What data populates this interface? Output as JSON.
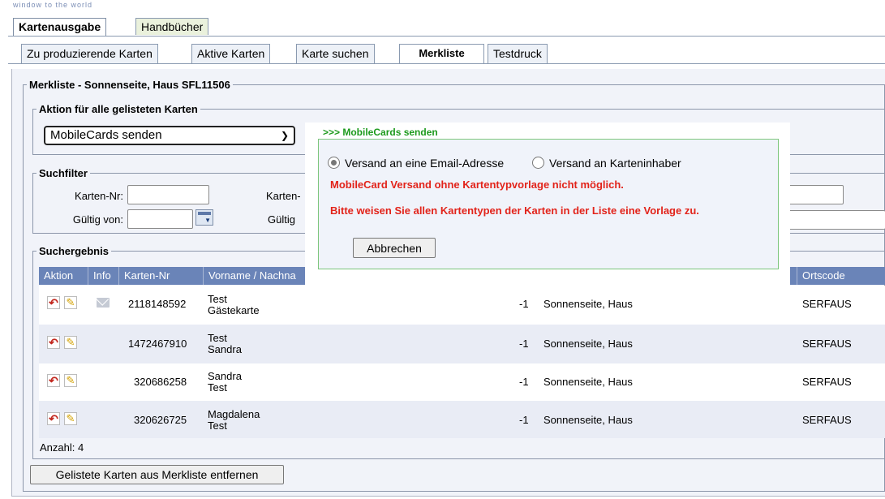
{
  "header": {
    "tagline": "window to the world"
  },
  "top_tabs": [
    {
      "label": "Kartenausgabe",
      "active": true
    },
    {
      "label": "Handbücher",
      "active": false
    }
  ],
  "sub_tabs": [
    {
      "label": "Zu produzierende Karten",
      "active": false
    },
    {
      "label": "Aktive Karten",
      "active": false
    },
    {
      "label": "Karte suchen",
      "active": false
    },
    {
      "label": "Merkliste",
      "active": true
    },
    {
      "label": "Testdruck",
      "active": false
    }
  ],
  "merkliste": {
    "legend": "Merkliste - Sonnenseite, Haus SFL11506",
    "aktion": {
      "legend": "Aktion für alle gelisteten Karten",
      "selected": "MobileCards senden"
    },
    "suchfilter": {
      "legend": "Suchfilter",
      "karten_nr_label": "Karten-Nr:",
      "karten_nr_value": "",
      "karten_label_partial": "Karten-",
      "gueltig_von_label": "Gültig von:",
      "gueltig_von_value": "",
      "gueltig_label_partial": "Gültig"
    },
    "suchergebnis": {
      "legend": "Suchergebnis",
      "columns": [
        "Aktion",
        "Info",
        "Karten-Nr",
        "Vorname / Nachna",
        "Ortscode"
      ],
      "rows": [
        {
          "karten_nr": "2118148592",
          "name1": "Test",
          "name2": "Gästekarte",
          "value": "-1",
          "haus": "Sonnenseite, Haus",
          "ortscode": "SERFAUS",
          "mail": true
        },
        {
          "karten_nr": "1472467910",
          "name1": "Test",
          "name2": "Sandra",
          "value": "-1",
          "haus": "Sonnenseite, Haus",
          "ortscode": "SERFAUS",
          "mail": false
        },
        {
          "karten_nr": "320686258",
          "name1": "Sandra",
          "name2": "Test",
          "value": "-1",
          "haus": "Sonnenseite, Haus",
          "ortscode": "SERFAUS",
          "mail": false
        },
        {
          "karten_nr": "320626725",
          "name1": "Magdalena",
          "name2": "Test",
          "value": "-1",
          "haus": "Sonnenseite, Haus",
          "ortscode": "SERFAUS",
          "mail": false
        }
      ],
      "count_label": "Anzahl: 4"
    },
    "remove_button": "Gelistete Karten aus Merkliste entfernen"
  },
  "dialog": {
    "title": ">>> MobileCards senden",
    "option_email": "Versand an eine Email-Adresse",
    "option_holder": "Versand an Karteninhaber",
    "selected_option": "email",
    "error1": "MobileCard Versand ohne Kartentypvorlage nicht möglich.",
    "error2": "Bitte weisen Sie allen Kartentypen der Karten in der Liste eine Vorlage zu.",
    "cancel_button": "Abbrechen"
  },
  "colors": {
    "table_header": "#6a84b8",
    "dialog_title": "#1c9a1c",
    "error": "#e2231a"
  }
}
